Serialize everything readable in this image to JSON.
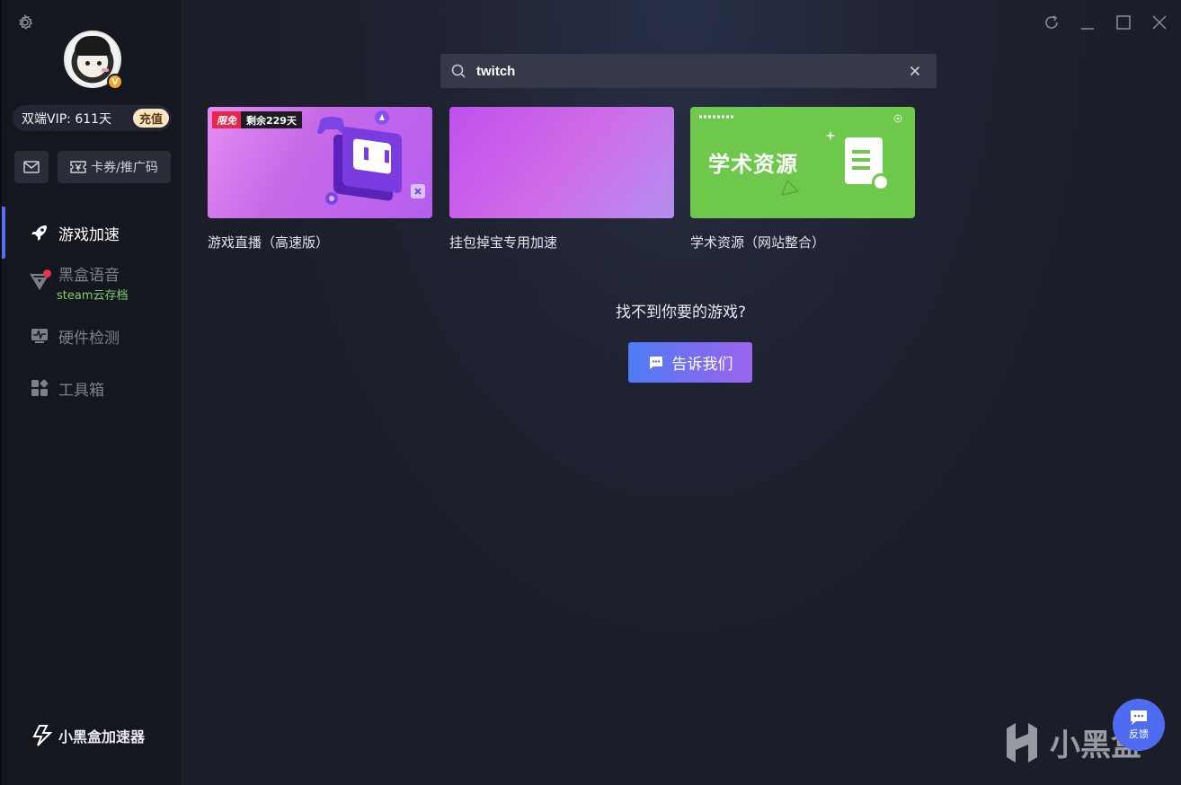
{
  "user": {
    "vip_label": "双端VIP: 611天",
    "recharge_label": "充值",
    "vip_badge": "V"
  },
  "sidebar": {
    "coupon_label": "卡券/推广码",
    "items": [
      {
        "label": "游戏加速",
        "icon": "rocket-icon"
      },
      {
        "label": "黑盒语音",
        "sub": "steam云存档",
        "icon": "voice-icon"
      },
      {
        "label": "硬件检测",
        "icon": "monitor-icon"
      },
      {
        "label": "工具箱",
        "icon": "toolbox-icon"
      }
    ],
    "brand": "小黑盒加速器"
  },
  "search": {
    "value": "twitch"
  },
  "results": [
    {
      "title": "游戏直播（高速版）",
      "promo_tag": "限免",
      "promo_remaining": "剩余229天"
    },
    {
      "title": "挂包掉宝专用加速"
    },
    {
      "title": "学术资源（网站整合）",
      "thumb_text": "学术资源"
    }
  ],
  "empty_prompt": "找不到你要的游戏?",
  "tell_us_label": "告诉我们",
  "watermark": "小黑盒",
  "feedback_label": "反馈",
  "colors": {
    "accent": "#5c6cf5",
    "green": "#6ec84c",
    "promo_red": "#e8254a"
  }
}
